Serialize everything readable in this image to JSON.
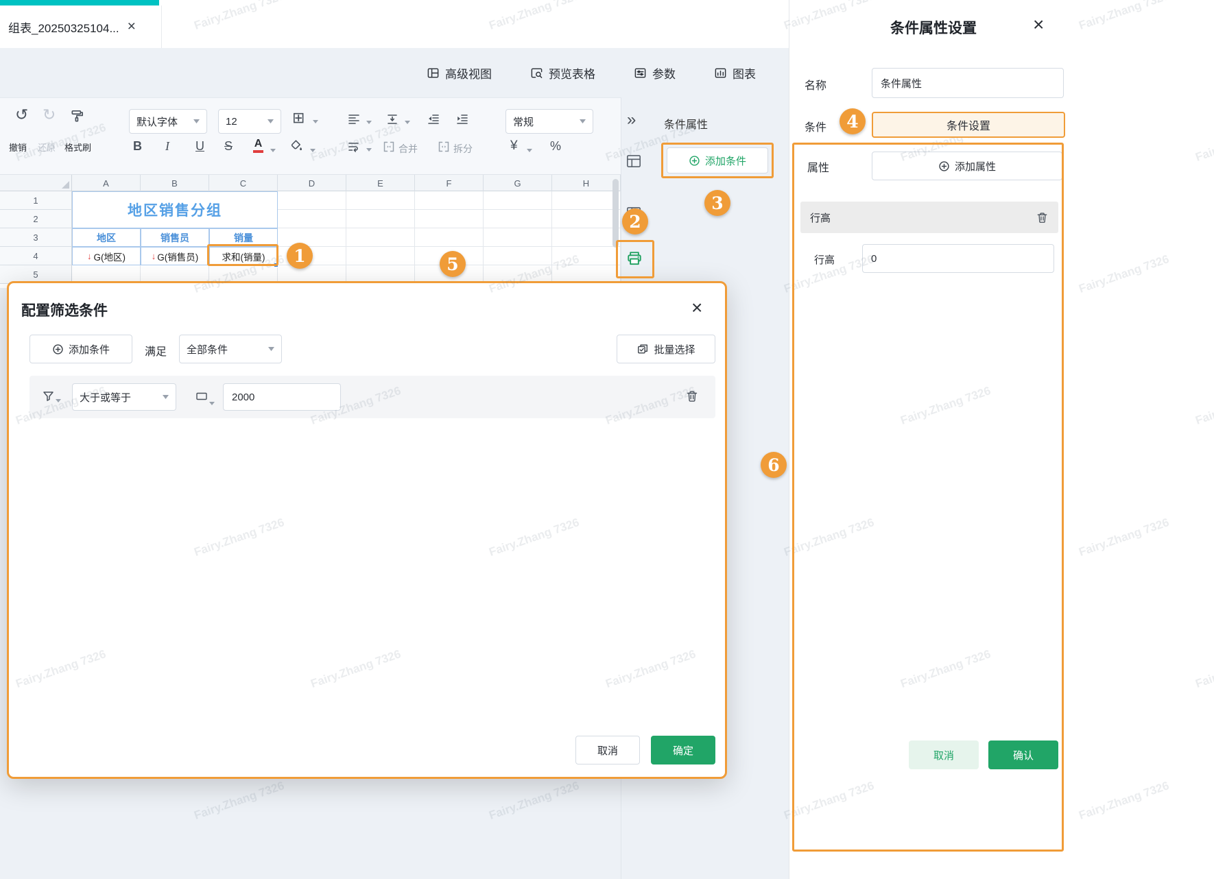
{
  "watermark": {
    "text": "Fairy.Zhang 7326"
  },
  "tab": {
    "title": "组表_20250325104...",
    "close": "×"
  },
  "top_actions": {
    "advanced_view": "高级视图",
    "preview_table": "预览表格",
    "params": "参数",
    "chart": "图表"
  },
  "toolbar": {
    "undo_icon": "↺",
    "redo_icon": "↻",
    "undo": "撤销",
    "redo": "还原",
    "format_painter": "格式刷",
    "font_name": "默认字体",
    "font_size": "12",
    "border_icon": "⊞",
    "bold": "B",
    "italic": "I",
    "underline": "U",
    "strike": "S",
    "font_color": "A",
    "merge": "合并",
    "split": "拆分",
    "number_format": "常规",
    "currency": "¥",
    "percent": "%"
  },
  "sheet": {
    "columns": [
      "A",
      "B",
      "C",
      "D",
      "E",
      "F",
      "G",
      "H"
    ],
    "rows": [
      "1",
      "2",
      "3",
      "4",
      "5"
    ],
    "title": "地区销售分组",
    "headers": [
      "地区",
      "销售员",
      "销量"
    ],
    "cells": {
      "a4_arrow": "↓",
      "a4": "G(地区)",
      "b4_arrow": "↓",
      "b4": "G(销售员)",
      "c4": "求和(销量)"
    }
  },
  "side": {
    "collapse": "»",
    "panel_title": "条件属性",
    "add_condition": "添加条件"
  },
  "modal": {
    "title": "配置筛选条件",
    "close": "×",
    "add_condition": "添加条件",
    "satisfy": "满足",
    "match_mode": "全部条件",
    "batch_select": "批量选择",
    "operator": "大于或等于",
    "value": "2000",
    "cancel": "取消",
    "confirm": "确定"
  },
  "panel": {
    "title": "条件属性设置",
    "close": "×",
    "name_label": "名称",
    "name_value": "条件属性",
    "condition_label": "条件",
    "condition_setting": "条件设置",
    "attr_label": "属性",
    "add_attr": "添加属性",
    "attr_item": "行高",
    "row_height_label": "行高",
    "row_height_value": "0",
    "cancel": "取消",
    "confirm": "确认"
  },
  "badges": [
    "1",
    "2",
    "3",
    "4",
    "5",
    "6"
  ]
}
